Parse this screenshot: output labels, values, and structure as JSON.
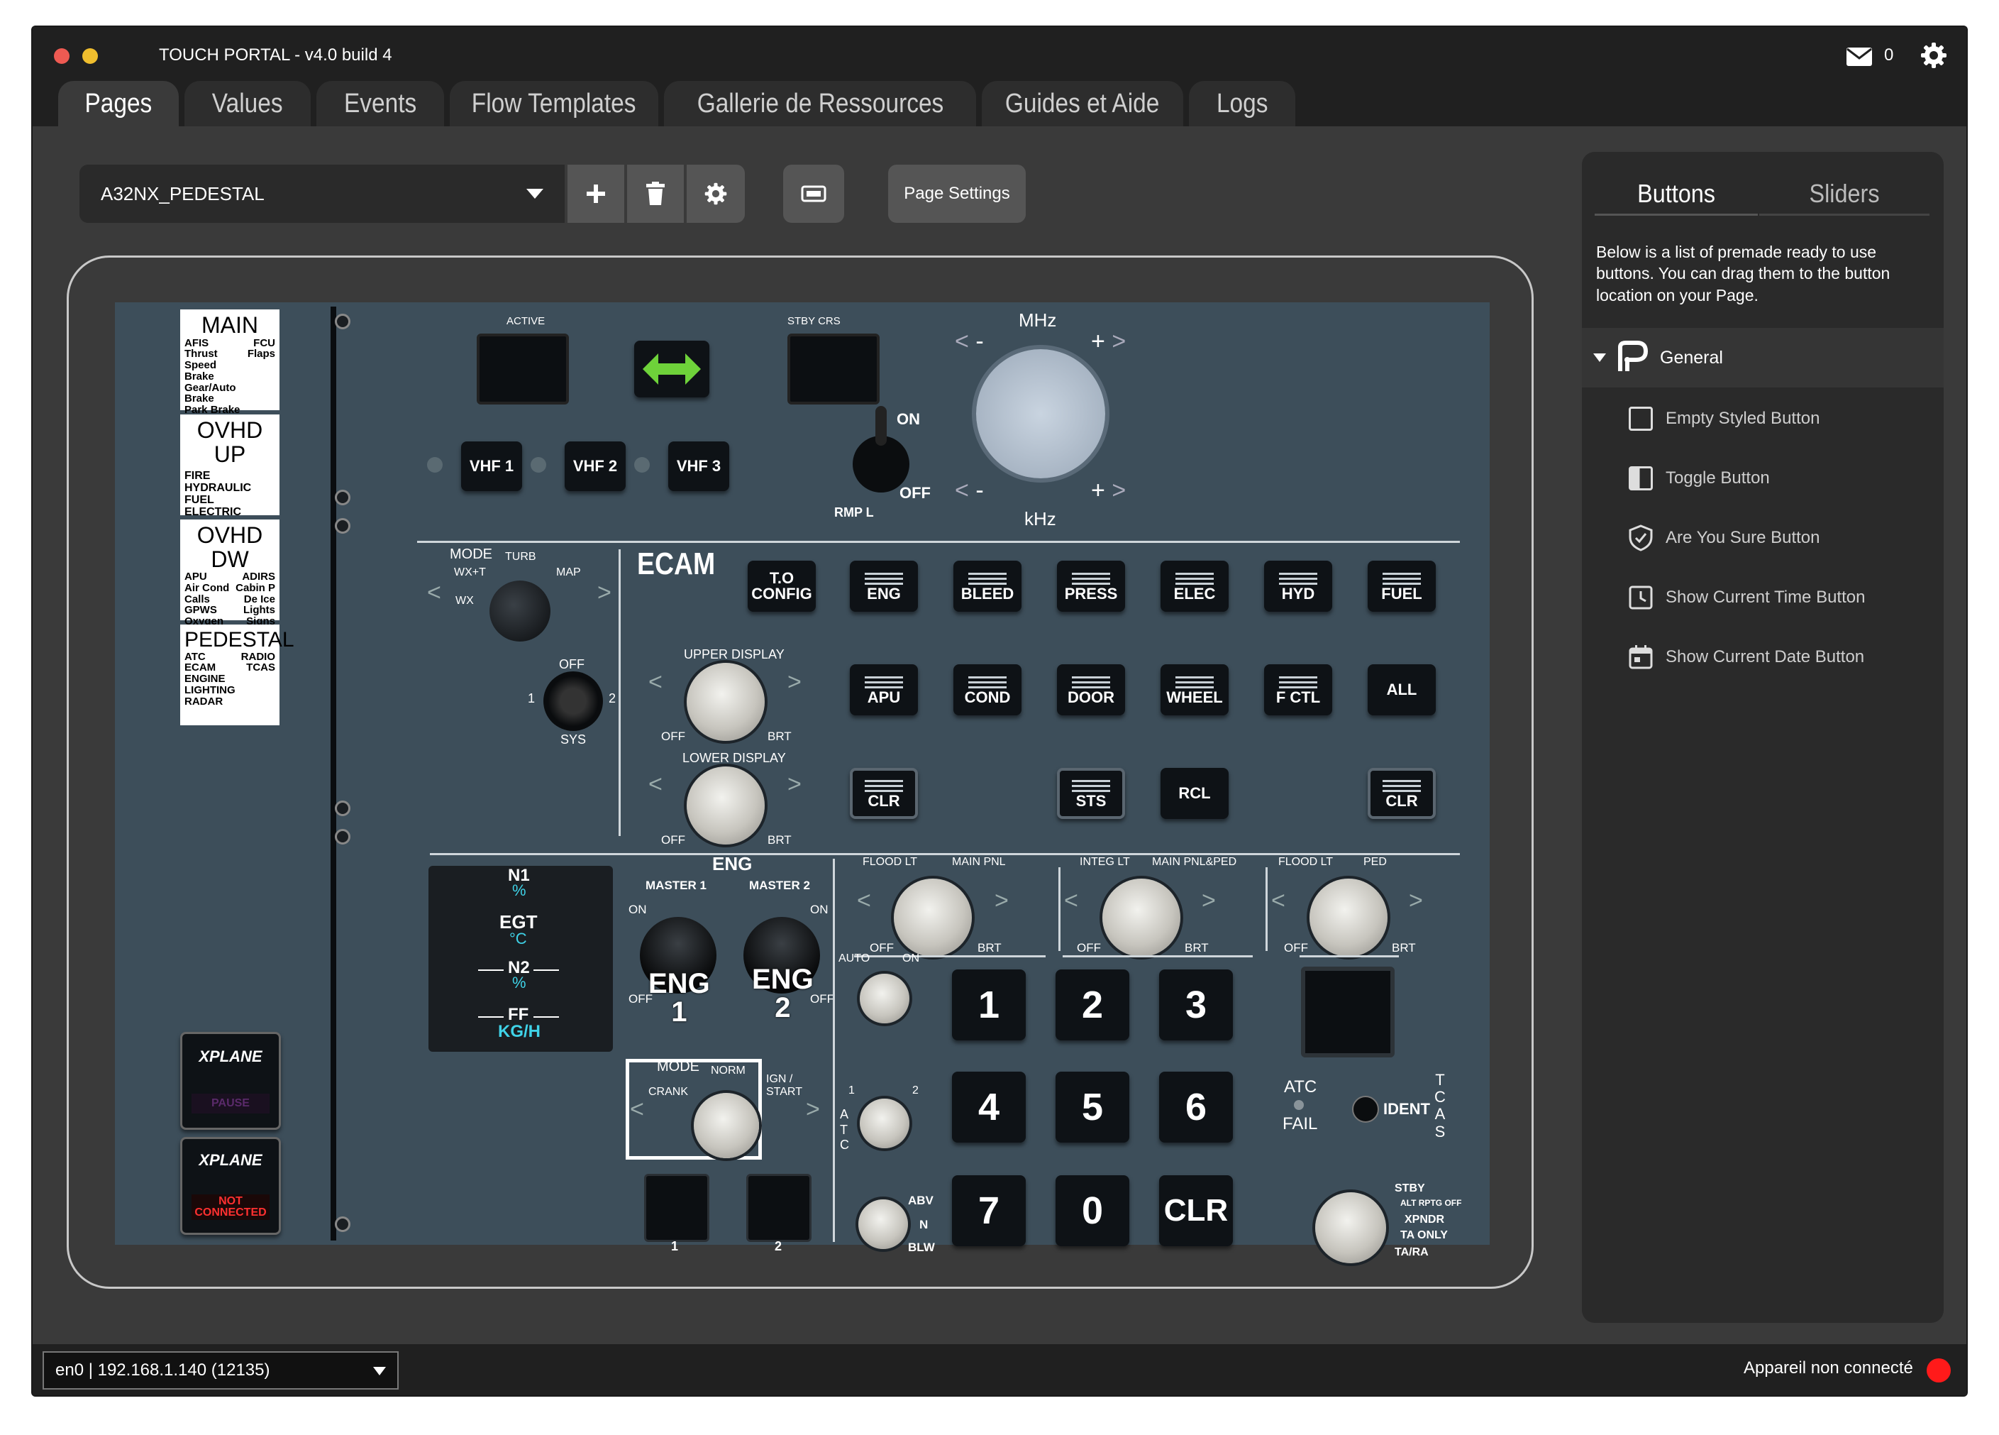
{
  "app": {
    "title": "TOUCH PORTAL - v4.0 build 4",
    "mail_count": "0"
  },
  "tabs": [
    "Pages",
    "Values",
    "Events",
    "Flow Templates",
    "Gallerie de Ressources",
    "Guides et Aide",
    "Logs"
  ],
  "active_tab": "Pages",
  "toolbar": {
    "page_select": "A32NX_PEDESTAL",
    "page_settings": "Page Settings"
  },
  "sidebar": {
    "tabs": [
      "Buttons",
      "Sliders"
    ],
    "description": "Below is a list of premade ready to use buttons. You can drag them to the button location on your Page.",
    "group": "General",
    "items": [
      "Empty Styled Button",
      "Toggle Button",
      "Are You Sure Button",
      "Show Current Time Button",
      "Show Current Date Button"
    ]
  },
  "statusbar": {
    "connection": "en0 | 192.168.1.140 (12135)",
    "status": "Appareil non connecté",
    "status_color": "#ff1a1a"
  },
  "pedestal": {
    "menu": {
      "main": {
        "title": "MAIN",
        "left": [
          "AFIS",
          "Thrust",
          "Speed Brake",
          "Gear/Auto Brake",
          "Park Brake"
        ],
        "right": [
          "FCU",
          "Flaps"
        ]
      },
      "ovhd_up": {
        "title": "OVHD UP",
        "left": [
          "FIRE",
          "HYDRAULIC",
          "FUEL",
          "ELECTRIC"
        ]
      },
      "ovhd_dw": {
        "title": "OVHD DW",
        "left": [
          "APU",
          "Air Cond",
          "Calls",
          "GPWS",
          "Oxygen"
        ],
        "right": [
          "ADIRS",
          "Cabin P",
          "De Ice",
          "Lights",
          "Signs"
        ]
      },
      "pedestal": {
        "title": "PEDESTAL",
        "left": [
          "ATC",
          "ECAM",
          "ENGINE",
          "LIGHTING",
          "RADAR"
        ],
        "right": [
          "RADIO",
          "TCAS"
        ]
      }
    },
    "xplane": {
      "logo": "XPLANE",
      "pause": "PAUSE",
      "not_connected": "NOT\nCONNECTED"
    },
    "radio": {
      "active": "ACTIVE",
      "stby": "STBY CRS",
      "mhz": "MHz",
      "khz": "kHz",
      "minus": "-",
      "plus": "+",
      "vhf": [
        "VHF 1",
        "VHF 2",
        "VHF 3"
      ],
      "on": "ON",
      "off": "OFF",
      "rmp": "RMP L"
    },
    "wx": {
      "mode": "MODE",
      "turb": "TURB",
      "wxt": "WX+T",
      "map": "MAP",
      "wx": "WX",
      "off": "OFF",
      "one": "1",
      "two": "2",
      "sys": "SYS"
    },
    "ecam": {
      "title": "ECAM",
      "row1": [
        "T.O\nCONFIG",
        "ENG",
        "BLEED",
        "PRESS",
        "ELEC",
        "HYD",
        "FUEL"
      ],
      "row2": [
        "APU",
        "COND",
        "DOOR",
        "WHEEL",
        "F CTL",
        "ALL"
      ],
      "row3": [
        "CLR",
        "STS",
        "RCL",
        "CLR"
      ],
      "upper": "UPPER DISPLAY",
      "lower": "LOWER DISPLAY",
      "off": "OFF",
      "brt": "BRT"
    },
    "eng": {
      "title": "ENG",
      "master1": "MASTER 1",
      "master2": "MASTER 2",
      "on": "ON",
      "off": "OFF",
      "labels": [
        "N1",
        "%",
        "EGT",
        "°C",
        "N2",
        "%",
        "FF",
        "KG/H"
      ],
      "eng1": "ENG\n1",
      "eng2": "ENG\n2",
      "mode": "MODE",
      "crank": "CRANK",
      "norm": "NORM",
      "ign": "IGN /\nSTART",
      "one": "1",
      "two": "2"
    },
    "lights": {
      "flood": "FLOOD LT",
      "main_pnl": "MAIN PNL",
      "integ": "INTEG LT",
      "main_ped": "MAIN PNL&PED",
      "ped": "PED",
      "off": "OFF",
      "brt": "BRT"
    },
    "atc": {
      "auto": "AUTO",
      "on": "ON",
      "one": "1",
      "two": "2",
      "atc_v": "A\nT\nC",
      "abv": "ABV",
      "n": "N",
      "blw": "BLW",
      "keys": [
        "1",
        "2",
        "3",
        "4",
        "5",
        "6",
        "7",
        "0",
        "CLR"
      ],
      "atc": "ATC",
      "fail": "FAIL",
      "ident": "IDENT",
      "tcas": "T\nC\nA\nS",
      "modes": [
        "STBY",
        "ALT RPTG OFF",
        "XPNDR",
        "TA ONLY",
        "TA/RA"
      ]
    }
  }
}
